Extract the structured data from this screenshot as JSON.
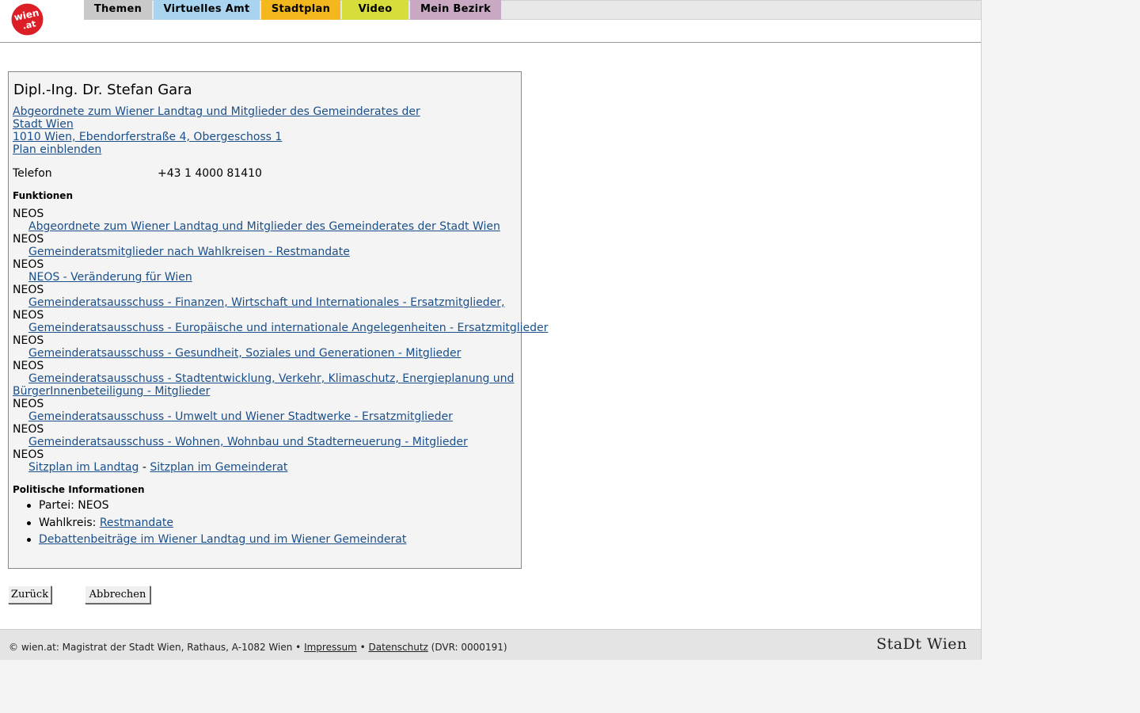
{
  "nav": {
    "tabs": [
      {
        "label": "Themen",
        "color": "#c9c9c9"
      },
      {
        "label": "Virtuelles Amt",
        "color": "#a8d4f0"
      },
      {
        "label": "Stadtplan",
        "color": "#f2b81e"
      },
      {
        "label": "Video",
        "color": "#d7dd3a"
      },
      {
        "label": "Mein Bezirk",
        "color": "#c9a8c4"
      }
    ],
    "logo_text_top": "wien",
    "logo_text_bottom": ".at",
    "logo_color": "#dc1f26"
  },
  "person": {
    "name": "Dipl.-Ing. Dr. Stefan Gara",
    "org_link_line1": "Abgeordnete zum Wiener Landtag und Mitglieder des Gemeinderates der",
    "org_link_line2": "Stadt Wien",
    "address_link": "1010 Wien, Ebendorferstraße 4, Obergeschoss 1",
    "plan_link": "Plan einblenden",
    "phone_label": "Telefon",
    "phone_value": "+43 1 4000 81410"
  },
  "functions": {
    "heading": "Funktionen",
    "items": [
      {
        "party": "NEOS",
        "link": "Abgeordnete zum Wiener Landtag und Mitglieder des Gemeinderates der Stadt Wien"
      },
      {
        "party": "NEOS",
        "link": "Gemeinderatsmitglieder nach Wahlkreisen - Restmandate"
      },
      {
        "party": "NEOS",
        "link": "NEOS - Veränderung für Wien"
      },
      {
        "party": "NEOS",
        "link": "Gemeinderatsausschuss - Finanzen, Wirtschaft und Internationales - Ersatzmitglieder, "
      },
      {
        "party": "NEOS",
        "link": "Gemeinderatsausschuss - Europäische und internationale Angelegenheiten - Ersatzmitglieder"
      },
      {
        "party": "NEOS",
        "link": "Gemeinderatsausschuss - Gesundheit, Soziales und Generationen - Mitglieder"
      },
      {
        "party": "NEOS",
        "link": "Gemeinderatsausschuss - Stadtentwicklung, Verkehr, Klimaschutz, Energieplanung und",
        "link_cont": "BürgerInnenbeteiligung - Mitglieder"
      },
      {
        "party": "NEOS",
        "link": "Gemeinderatsausschuss - Umwelt und Wiener Stadtwerke - Ersatzmitglieder"
      },
      {
        "party": "NEOS",
        "link": "Gemeinderatsausschuss - Wohnen, Wohnbau und Stadterneuerung - Mitglieder"
      },
      {
        "party": "NEOS",
        "link": "Sitzplan im Landtag",
        "separator": " - ",
        "link2": "Sitzplan im Gemeinderat"
      }
    ]
  },
  "political": {
    "heading": "Politische Informationen",
    "partei_label": "Partei: NEOS",
    "wahlkreis_label": "Wahlkreis: ",
    "wahlkreis_link": "Restmandate",
    "debatten_link": "Debattenbeiträge im Wiener Landtag und im Wiener Gemeinderat"
  },
  "buttons": {
    "back": "Zurück",
    "cancel": "Abbrechen"
  },
  "footer": {
    "copyright": "© wien.at: Magistrat der Stadt Wien, Rathaus, A-1082 Wien • ",
    "impressum": "Impressum",
    "bullet": " • ",
    "datenschutz": "Datenschutz",
    "dvr": " (DVR: 0000191)",
    "brand": "StaDt Wien"
  }
}
